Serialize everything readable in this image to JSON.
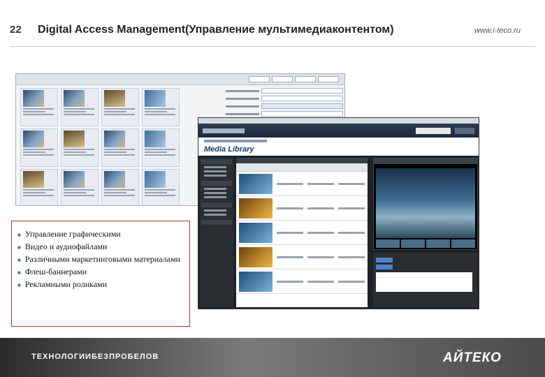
{
  "slide": {
    "number": "22",
    "title": "Digital Access Management(Управление мультимедиаконтентом)",
    "url": "www.i-teco.ru"
  },
  "media_manager": {
    "library_title": "Media Library"
  },
  "bullets": [
    "Управление графическими",
    "Видео и аудиофайлами",
    "Различными маркетинговыми материалами",
    "Флеш-баннерами",
    "Рекламными роликами"
  ],
  "footer": {
    "tagline": "ТЕХНОЛОГИИБЕЗПРОБЕЛОВ",
    "brand": "АЙТЕКО"
  }
}
